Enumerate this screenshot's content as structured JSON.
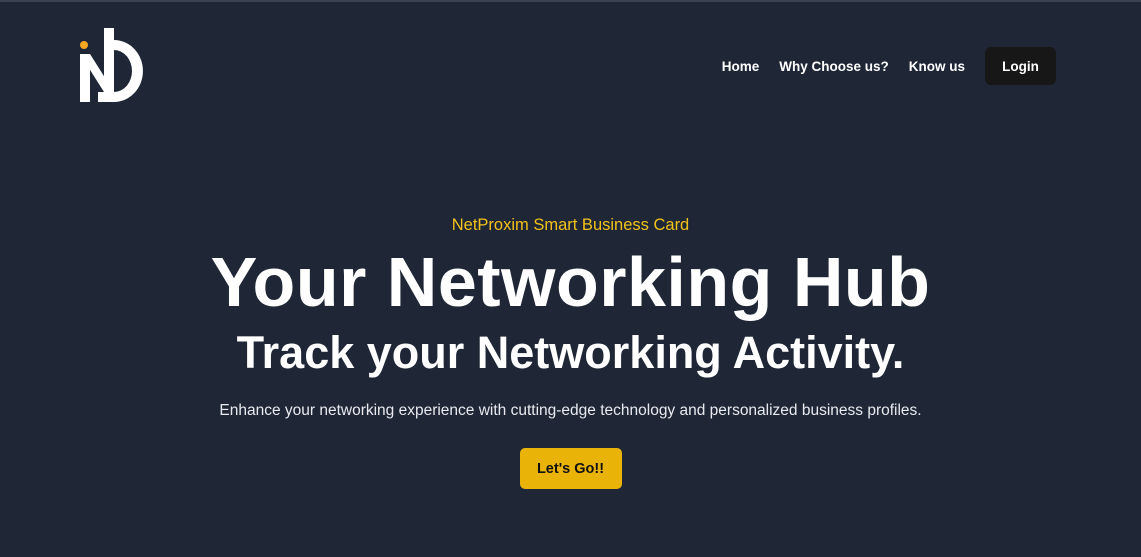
{
  "nav": {
    "links": [
      {
        "label": "Home"
      },
      {
        "label": "Why Choose us?"
      },
      {
        "label": "Know us"
      }
    ],
    "login_label": "Login"
  },
  "hero": {
    "eyebrow": "NetProxim Smart Business Card",
    "headline": "Your Networking Hub",
    "subheadline": "Track your Networking Activity.",
    "description": "Enhance your networking experience with cutting-edge technology and personalized business profiles.",
    "cta_label": "Let's Go!!"
  },
  "colors": {
    "background": "#1f2736",
    "accent": "#eab308",
    "eyebrow_text": "#f2c21b",
    "login_button": "#171717",
    "logo_dot": "#f5a623"
  },
  "icons": {
    "logo": "netproxim-logo-icon"
  }
}
